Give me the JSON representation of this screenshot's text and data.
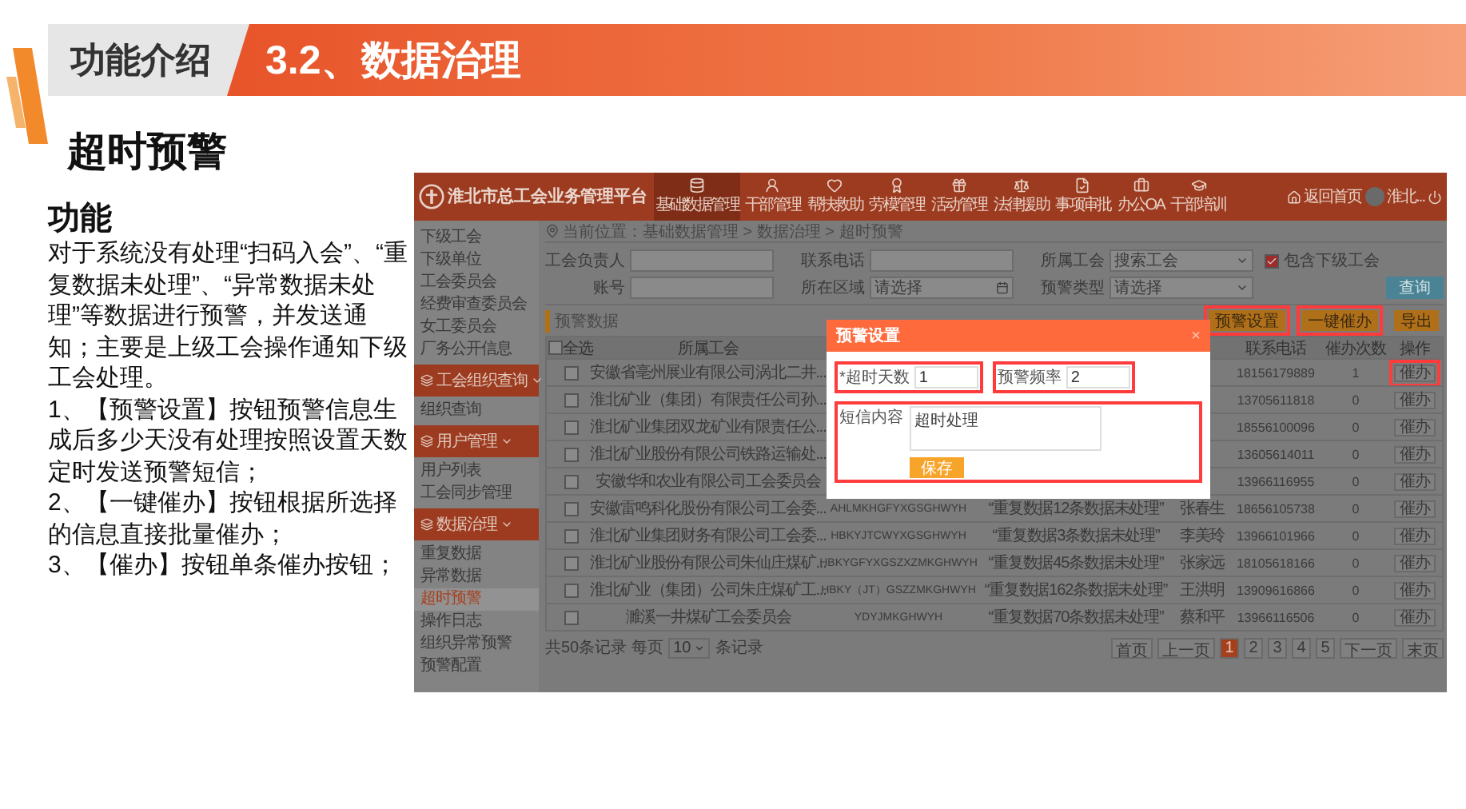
{
  "header": {
    "section": "功能介绍",
    "title": "3.2、数据治理"
  },
  "heading": "超时预警",
  "description": {
    "title": "功能",
    "paragraphs": [
      "对于系统没有处理“扫码入会”、“重复数据未处理”、“异常数据未处理”等数据进行预警，并发送通知；主要是上级工会操作通知下级工会处理。",
      "1、【预警设置】按钮预警信息生成后多少天没有处理按照设置天数定时发送预警短信；",
      "2、【一键催办】按钮根据所选择的信息直接批量催办；",
      "3、【催办】按钮单条催办按钮；"
    ]
  },
  "app": {
    "title": "淮北市总工会业务管理平台",
    "nav": [
      {
        "label": "基础数据管理",
        "selected": true
      },
      {
        "label": "干部管理",
        "selected": false
      },
      {
        "label": "帮扶救助",
        "selected": false
      },
      {
        "label": "劳模管理",
        "selected": false
      },
      {
        "label": "活动管理",
        "selected": false
      },
      {
        "label": "法律援助",
        "selected": false
      },
      {
        "label": "事项审批",
        "selected": false
      },
      {
        "label": "办公OA",
        "selected": false
      },
      {
        "label": "干部培训",
        "selected": false
      }
    ],
    "home": "返回首页",
    "user": "淮北...",
    "sidebar": [
      {
        "label": "下级工会",
        "kind": "item",
        "selected": false
      },
      {
        "label": "下级单位",
        "kind": "item",
        "selected": false
      },
      {
        "label": "工会委员会",
        "kind": "item",
        "selected": false
      },
      {
        "label": "经费审查委员会",
        "kind": "item",
        "selected": false
      },
      {
        "label": "女工委员会",
        "kind": "item",
        "selected": false
      },
      {
        "label": "厂务公开信息",
        "kind": "item",
        "selected": false
      },
      {
        "label": "工会组织查询",
        "kind": "group"
      },
      {
        "label": "组织查询",
        "kind": "item",
        "selected": false
      },
      {
        "label": "用户管理",
        "kind": "group"
      },
      {
        "label": "用户列表",
        "kind": "item",
        "selected": false
      },
      {
        "label": "工会同步管理",
        "kind": "item",
        "selected": false
      },
      {
        "label": "数据治理",
        "kind": "group"
      },
      {
        "label": "重复数据",
        "kind": "item",
        "selected": false
      },
      {
        "label": "异常数据",
        "kind": "item",
        "selected": false
      },
      {
        "label": "超时预警",
        "kind": "item",
        "selected": true
      },
      {
        "label": "操作日志",
        "kind": "item",
        "selected": false
      },
      {
        "label": "组织异常预警",
        "kind": "item",
        "selected": false
      },
      {
        "label": "预警配置",
        "kind": "item",
        "selected": false
      }
    ],
    "breadcrumb": "当前位置：基础数据管理 > 数据治理 > 超时预警",
    "filters": [
      {
        "label": "工会负责人",
        "kind": "input"
      },
      {
        "label": "联系电话",
        "kind": "input"
      },
      {
        "label": "所属工会",
        "kind": "select",
        "placeholder": "搜索工会"
      },
      {
        "label": "包含下级工会",
        "kind": "checkbox",
        "checked": true
      },
      {
        "label": "账号",
        "kind": "input"
      },
      {
        "label": "所在区域",
        "kind": "date",
        "placeholder": "请选择"
      },
      {
        "label": "预警类型",
        "kind": "select",
        "placeholder": "请选择"
      }
    ],
    "search_button": "查询",
    "section_title": "预警数据",
    "actions": [
      {
        "label": "预警设置",
        "highlighted": true
      },
      {
        "label": "一键催办",
        "highlighted": true
      },
      {
        "label": "导出",
        "highlighted": false
      }
    ],
    "table": {
      "columns": [
        "全选",
        "所属工会",
        "联系电话",
        "催办次数",
        "操作"
      ],
      "select_all_checked": false,
      "rows": [
        {
          "checked": false,
          "union": "安徽省亳州展业有限公司涡北二井...",
          "phone": "18156179889",
          "count": "1",
          "action": "催办",
          "highlighted": true
        },
        {
          "checked": false,
          "union": "淮北矿业（集团）有限责任公司孙...",
          "phone": "13705611818",
          "count": "0",
          "action": "催办",
          "highlighted": false
        },
        {
          "checked": false,
          "union": "淮北矿业集团双龙矿业有限责任公...",
          "phone": "18556100096",
          "count": "0",
          "action": "催办",
          "highlighted": false
        },
        {
          "checked": false,
          "union": "淮北矿业股份有限公司铁路运输处...",
          "phone": "13605614011",
          "count": "0",
          "action": "催办",
          "highlighted": false
        },
        {
          "checked": false,
          "union": "安徽华和农业有限公司工会委员会",
          "phone": "13966116955",
          "count": "0",
          "action": "催办",
          "highlighted": false
        },
        {
          "checked": false,
          "union": "安徽雷鸣科化股份有限公司工会委...",
          "account": "AHLMKHGFYXGSGHWYH",
          "content": "“重复数据12条数据未处理”",
          "contact": "张春生",
          "phone": "18656105738",
          "count": "0",
          "action": "催办",
          "highlighted": false
        },
        {
          "checked": false,
          "union": "淮北矿业集团财务有限公司工会委...",
          "account": "HBKYJTCWYXGSGHWYH",
          "content": "“重复数据3条数据未处理”",
          "contact": "李美玲",
          "phone": "13966101966",
          "count": "0",
          "action": "催办",
          "highlighted": false
        },
        {
          "checked": false,
          "union": "淮北矿业股份有限公司朱仙庄煤矿...",
          "account": "HBKYGFYXGSZXZMKGHWYH",
          "content": "“重复数据45条数据未处理”",
          "contact": "张家远",
          "phone": "18105618166",
          "count": "0",
          "action": "催办",
          "highlighted": false
        },
        {
          "checked": false,
          "union": "淮北矿业（集团）公司朱庄煤矿工...",
          "account": "HBKY（JT）GSZZMKGHWYH",
          "content": "“重复数据162条数据未处理”",
          "contact": "王洪明",
          "phone": "13909616866",
          "count": "0",
          "action": "催办",
          "highlighted": false
        },
        {
          "checked": false,
          "union": "濉溪一井煤矿工会委员会",
          "account": "YDYJMKGHWYH",
          "content": "“重复数据70条数据未处理”",
          "contact": "蔡和平",
          "phone": "13966116506",
          "count": "0",
          "action": "催办",
          "highlighted": false
        }
      ]
    },
    "pagination": {
      "total": "共50条记录",
      "per_page_label": "每页",
      "per_page": "10",
      "per_page_suffix": "条记录",
      "pages": [
        {
          "label": "首页",
          "selected": false
        },
        {
          "label": "上一页",
          "selected": false
        },
        {
          "label": "1",
          "selected": true
        },
        {
          "label": "2",
          "selected": false
        },
        {
          "label": "3",
          "selected": false
        },
        {
          "label": "4",
          "selected": false
        },
        {
          "label": "5",
          "selected": false
        },
        {
          "label": "下一页",
          "selected": false
        },
        {
          "label": "末页",
          "selected": false
        }
      ]
    },
    "dialog": {
      "title": "预警设置",
      "close": "×",
      "fields": [
        {
          "label": "*超时天数",
          "value": "1"
        },
        {
          "label": "预警频率",
          "value": "2"
        }
      ],
      "message_label": "短信内容",
      "message": "超时处理",
      "save": "保存"
    }
  }
}
